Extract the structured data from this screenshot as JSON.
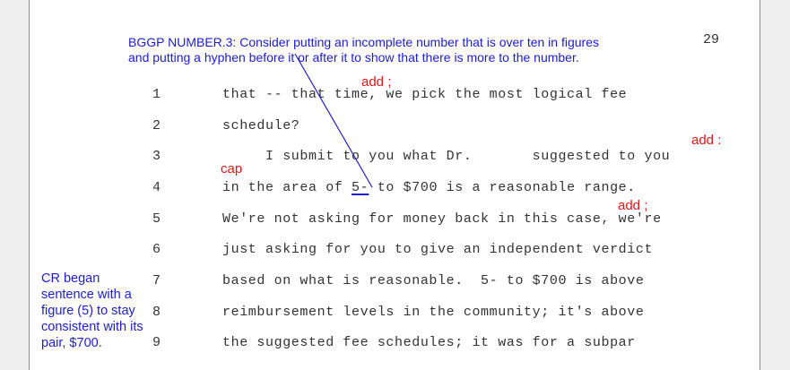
{
  "page_number": "29",
  "lines": [
    {
      "num": "1",
      "text": "that -- that time, we pick the most logical fee"
    },
    {
      "num": "2",
      "text": "schedule?"
    },
    {
      "num": "3",
      "text": "     I submit to you what Dr.       suggested to you"
    },
    {
      "num": "4",
      "pre": "in the area of ",
      "marked": "5-",
      "post": " to $700 is a reasonable range."
    },
    {
      "num": "5",
      "text": "We're not asking for money back in this case, we're"
    },
    {
      "num": "6",
      "text": "just asking for you to give an independent verdict"
    },
    {
      "num": "7",
      "text": "based on what is reasonable.  5- to $700 is above"
    },
    {
      "num": "8",
      "text": "reimbursement levels in the community; it's above"
    },
    {
      "num": "9",
      "text": "the suggested fee schedules; it was for a subpar"
    }
  ],
  "annotations": {
    "bggp_note_line1": "BGGP NUMBER.3: Consider putting an incomplete number that is over ten in figures",
    "bggp_note_line2": "and putting a hyphen before it or after it to show that there is more to the number.",
    "add_semicolon_1": "add ;",
    "add_colon": "add :",
    "cap": "cap",
    "add_semicolon_2": "add ;",
    "cr_note_lines": [
      "CR began",
      "sentence with a",
      "figure (5) to stay",
      "consistent with its",
      "pair, $700."
    ]
  },
  "colors": {
    "annotation_blue": "#1c1cd6",
    "annotation_red": "#e21414",
    "transcript_text": "#333333"
  }
}
